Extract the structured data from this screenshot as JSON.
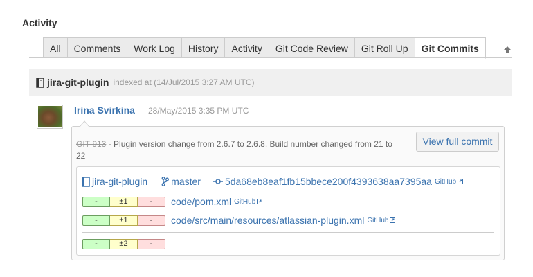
{
  "section": {
    "title": "Activity"
  },
  "tabs": [
    {
      "label": "All"
    },
    {
      "label": "Comments"
    },
    {
      "label": "Work Log"
    },
    {
      "label": "History"
    },
    {
      "label": "Activity"
    },
    {
      "label": "Git Code Review"
    },
    {
      "label": "Git Roll Up"
    },
    {
      "label": "Git Commits",
      "active": true
    }
  ],
  "repo": {
    "name": "jira-git-plugin",
    "indexed_text": "indexed at (14/Jul/2015 3:27 AM UTC)"
  },
  "commit": {
    "author": "Irina Svirkina",
    "date": "28/May/2015 3:35 PM UTC",
    "issue_key": "GIT-913",
    "message_rest": " - Plugin version change from 2.6.7 to 2.6.8. Build number changed from 21 to 22",
    "view_button": "View full commit",
    "repo_label": "jira-git-plugin",
    "branch": "master",
    "hash": "5da68eb8eaf1fb15bbece200f4393638aa7395aa",
    "hash_source": "GitHub",
    "files": [
      {
        "add": "-",
        "mod": "±1",
        "del": "-",
        "path": "code/pom.xml",
        "source": "GitHub"
      },
      {
        "add": "-",
        "mod": "±1",
        "del": "-",
        "path": "code/src/main/resources/atlassian-plugin.xml",
        "source": "GitHub"
      }
    ],
    "totals": {
      "add": "-",
      "mod": "±2",
      "del": "-"
    }
  },
  "colors": {
    "link": "#3b73af",
    "added_bg": "#ccffc6",
    "modified_bg": "#ffffcc",
    "deleted_bg": "#ffdede"
  }
}
